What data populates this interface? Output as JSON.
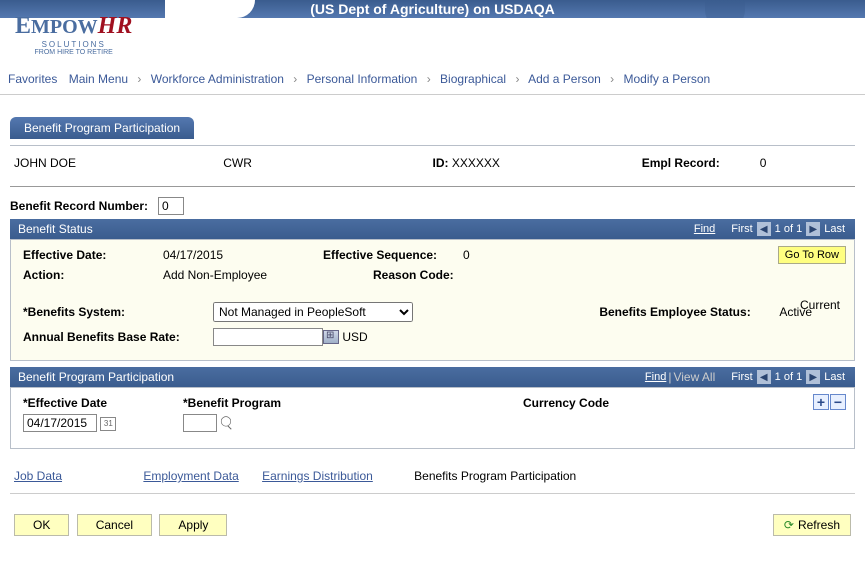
{
  "banner": {
    "title": "(US Dept of Agriculture) on USDAQA"
  },
  "logo": {
    "part1": "E",
    "part2": "MPOW",
    "part3": "HR",
    "sub1": "SOLUTIONS",
    "sub2": "FROM HIRE TO RETIRE"
  },
  "breadcrumb": {
    "items": [
      "Favorites",
      "Main Menu",
      "Workforce Administration",
      "Personal Information",
      "Biographical",
      "Add a Person",
      "Modify a Person"
    ]
  },
  "tab": {
    "label": "Benefit Program Participation"
  },
  "person": {
    "name": "JOHN DOE",
    "type": "CWR",
    "id_label": "ID:",
    "id_value": "XXXXXX",
    "empl_rec_label": "Empl Record:",
    "empl_rec_value": "0"
  },
  "benefit_record": {
    "label": "Benefit Record Number:",
    "value": "0"
  },
  "benefit_status": {
    "header": "Benefit Status",
    "find": "Find",
    "nav_first": "First",
    "nav_page": "1 of 1",
    "nav_last": "Last",
    "go_to_row": "Go To Row",
    "eff_date_label": "Effective Date:",
    "eff_date_value": "04/17/2015",
    "eff_seq_label": "Effective Sequence:",
    "eff_seq_value": "0",
    "action_label": "Action:",
    "action_value": "Add Non-Employee",
    "reason_label": "Reason Code:",
    "reason_value": "",
    "current": "Current",
    "benefits_system_label": "*Benefits System:",
    "benefits_system_value": "Not Managed in PeopleSoft",
    "base_rate_label": "Annual Benefits Base Rate:",
    "base_rate_value": "",
    "base_rate_currency": "USD",
    "emp_status_label": "Benefits Employee Status:",
    "emp_status_value": "Active"
  },
  "participation": {
    "header": "Benefit Program Participation",
    "find": "Find",
    "view_all": "View All",
    "nav_first": "First",
    "nav_page": "1 of 1",
    "nav_last": "Last",
    "eff_date_label": "*Effective Date",
    "eff_date_value": "04/17/2015",
    "program_label": "*Benefit Program",
    "program_value": "",
    "currency_label": "Currency Code"
  },
  "bottom_links": {
    "job_data": "Job Data",
    "employment_data": "Employment Data",
    "earnings_dist": "Earnings Distribution",
    "benefits_prog": "Benefits Program Participation"
  },
  "buttons": {
    "ok": "OK",
    "cancel": "Cancel",
    "apply": "Apply",
    "refresh": "Refresh"
  }
}
